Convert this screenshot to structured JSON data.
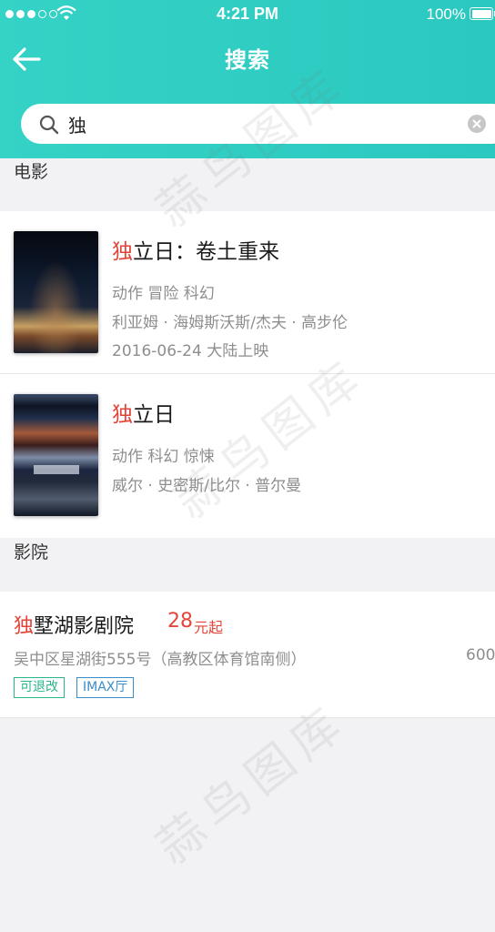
{
  "status_bar": {
    "time": "4:21 PM",
    "battery": "100%"
  },
  "nav": {
    "title": "搜索",
    "back_icon": "arrow-left-icon"
  },
  "search": {
    "value": "独",
    "placeholder": "",
    "clear_icon": "clear-icon"
  },
  "sections": {
    "movies": "电影",
    "cinemas": "影院"
  },
  "movies": [
    {
      "title_highlight": "独",
      "title_rest": "立日：卷土重来",
      "genres": "动作 冒险 科幻",
      "cast": "利亚姆 · 海姆斯沃斯/杰夫 · 高步伦",
      "release": "2016-06-24 大陆上映"
    },
    {
      "title_highlight": "独",
      "title_rest": "立日",
      "genres": "动作 科幻 惊悚",
      "cast": "威尔 · 史密斯/比尔 · 普尔曼"
    }
  ],
  "cinema": {
    "name_highlight": "独",
    "name_rest": "墅湖影剧院",
    "price": "28",
    "price_unit": "元起",
    "address": "吴中区星湖街555号（高教区体育馆南侧）",
    "distance": "600",
    "tags": [
      "可退改",
      "IMAX厅"
    ]
  },
  "watermark": "蒜鸟图库",
  "colors": {
    "header": "#2ac8bf",
    "highlight": "#e2463a",
    "tag_green": "#2bb58a",
    "tag_blue": "#3a8dc8"
  }
}
